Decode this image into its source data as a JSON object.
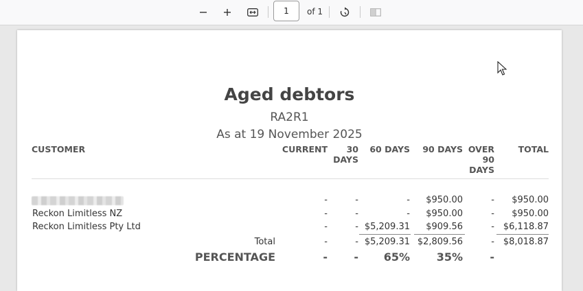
{
  "toolbar": {
    "page_number": "1",
    "page_of": "of 1"
  },
  "report": {
    "title": "Aged debtors",
    "subtitle": "RA2R1",
    "as_at": "As at 19 November 2025"
  },
  "columns": {
    "customer": "CUSTOMER",
    "current": "CURRENT",
    "days30": [
      "30",
      "DAYS"
    ],
    "days60": "60 DAYS",
    "days90": "90 DAYS",
    "over90": [
      "OVER",
      "90",
      "DAYS"
    ],
    "total": "TOTAL"
  },
  "rows": [
    {
      "customer": "",
      "current": "-",
      "d30": "-",
      "d60": "-",
      "d90": "$950.00",
      "over": "-",
      "total": "$950.00"
    },
    {
      "customer": "Reckon Limitless NZ",
      "current": "-",
      "d30": "-",
      "d60": "-",
      "d90": "$950.00",
      "over": "-",
      "total": "$950.00"
    },
    {
      "customer": "Reckon Limitless Pty Ltd",
      "current": "-",
      "d30": "-",
      "d60": "$5,209.31",
      "d90": "$909.56",
      "over": "-",
      "total": "$6,118.87"
    }
  ],
  "total_row": {
    "label": "Total",
    "current": "-",
    "d30": "-",
    "d60": "$5,209.31",
    "d90": "$2,809.56",
    "over": "-",
    "total": "$8,018.87"
  },
  "percentage_row": {
    "label": "PERCENTAGE",
    "current": "-",
    "d30": "-",
    "d60": "65%",
    "d90": "35%",
    "over": "-"
  }
}
